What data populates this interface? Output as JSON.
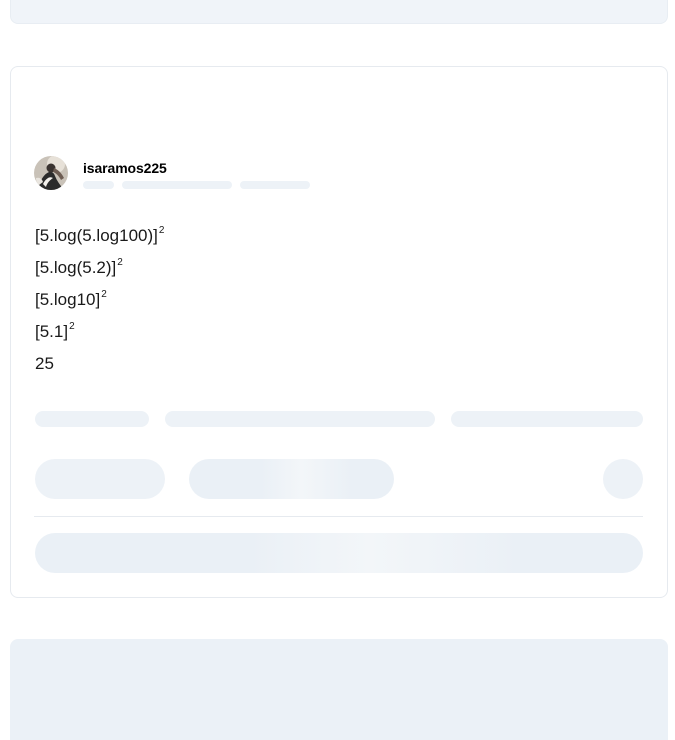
{
  "answer": {
    "author": {
      "username": "isaramos225",
      "avatar_icon": "user-avatar-photo"
    },
    "lines": [
      {
        "text": "[5.log(5.log100)]",
        "sup": "2"
      },
      {
        "text": "[5.log(5.2)]",
        "sup": "2"
      },
      {
        "text": "[5.log10]",
        "sup": "2"
      },
      {
        "text": "[5.1]",
        "sup": "2"
      },
      {
        "text": "25",
        "sup": ""
      }
    ]
  },
  "colors": {
    "skeleton": "#edf2f7",
    "card_border": "#e6eaef",
    "text": "#1a1a1a"
  }
}
